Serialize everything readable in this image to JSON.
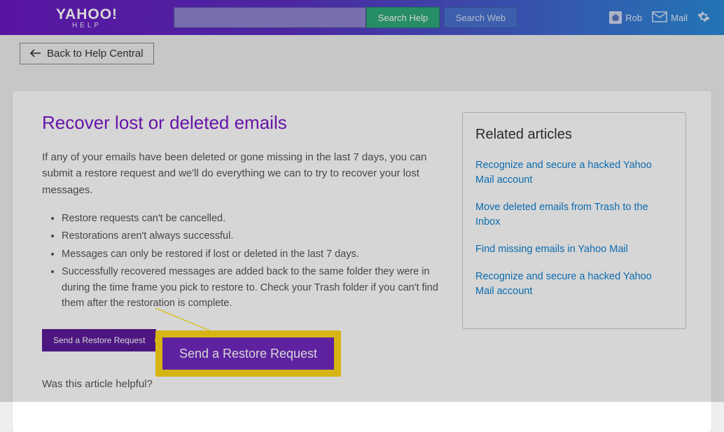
{
  "header": {
    "logo_main": "YAHOO!",
    "logo_sub": "HELP",
    "search_help": "Search Help",
    "search_web": "Search Web",
    "user_name": "Rob",
    "mail_label": "Mail"
  },
  "back_label": "Back to Help Central",
  "article": {
    "title": "Recover lost or deleted emails",
    "intro": "If any of your emails have been deleted or gone missing in the last 7 days, you can submit a restore request and we'll do everything we can to try to recover your lost messages.",
    "bullets": [
      "Restore requests can't be cancelled.",
      "Restorations aren't always successful.",
      "Messages can only be restored if lost or deleted in the last 7 days.",
      "Successfully recovered messages are added back to the same folder they were in during the time frame you pick to restore to. Check your Trash folder if you can't find them after the restoration is complete."
    ],
    "restore_btn": "Send a Restore Request",
    "helpful": "Was this article helpful?"
  },
  "related": {
    "heading": "Related articles",
    "links": [
      "Recognize and secure a hacked Yahoo Mail account",
      "Move deleted emails from Trash to the Inbox",
      "Find missing emails in Yahoo Mail",
      "Recognize and secure a hacked Yahoo Mail account"
    ]
  },
  "callout_label": "Send a Restore Request"
}
